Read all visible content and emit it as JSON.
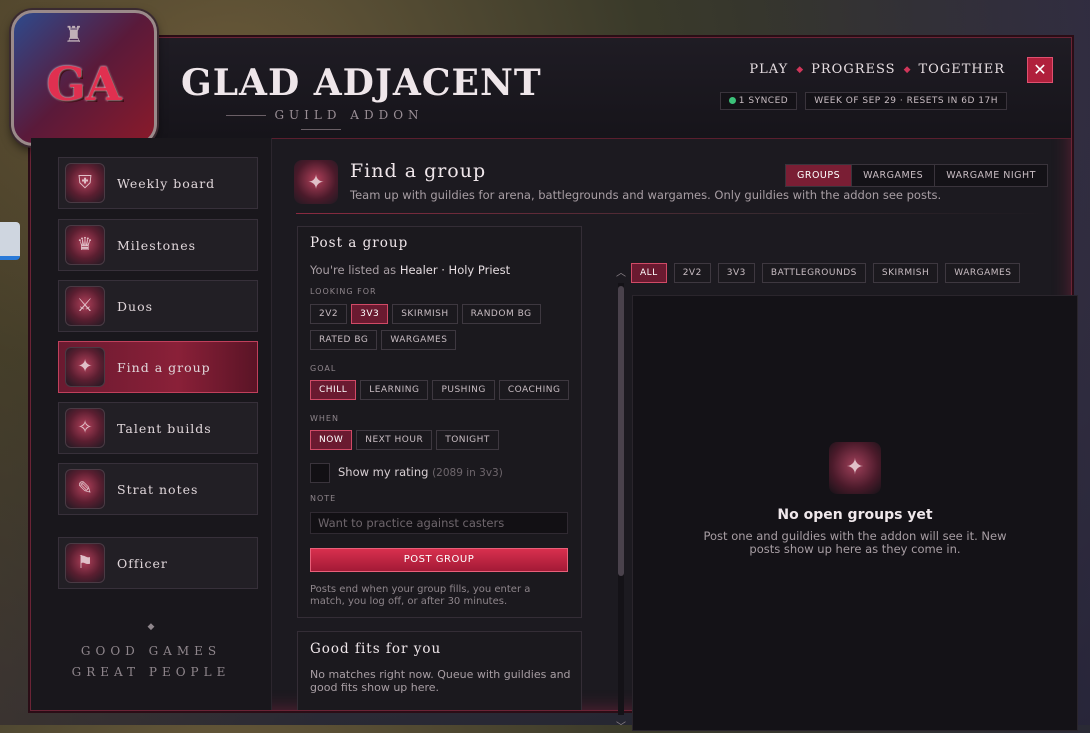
{
  "app": {
    "title": "GLAD ADJACENT",
    "subtitle": "GUILD ADDON",
    "logo_text": "GA"
  },
  "topnav": {
    "items": [
      "PLAY",
      "PROGRESS",
      "TOGETHER"
    ]
  },
  "status": {
    "synced": "1 SYNCED",
    "week": "WEEK OF SEP 29 · RESETS IN 6D 17H",
    "synced_color": "#3cc27a"
  },
  "colors": {
    "accent": "#c8284a",
    "active_bg": "#7a1e34",
    "panel_bg": "#1b191e"
  },
  "sidebar": {
    "items": [
      {
        "label": "Weekly board",
        "icon": "shield-crest-icon"
      },
      {
        "label": "Milestones",
        "icon": "trophy-crest-icon"
      },
      {
        "label": "Duos",
        "icon": "crossed-swords-icon"
      },
      {
        "label": "Find a group",
        "icon": "group-crest-icon",
        "active": true
      },
      {
        "label": "Talent builds",
        "icon": "spellbook-icon"
      },
      {
        "label": "Strat notes",
        "icon": "scroll-icon"
      },
      {
        "label": "Officer",
        "icon": "banners-icon"
      }
    ],
    "motto": [
      "GOOD GAMES",
      "GREAT PEOPLE"
    ]
  },
  "page": {
    "title": "Find a group",
    "description": "Team up with guildies for arena, battlegrounds and wargames. Only guildies with the addon see posts.",
    "tabs": [
      {
        "label": "GROUPS",
        "active": true
      },
      {
        "label": "WARGAMES"
      },
      {
        "label": "WARGAME NIGHT"
      }
    ]
  },
  "post": {
    "title": "Post a group",
    "listed_prefix": "You're listed as",
    "listed_role": "Healer · Holy Priest",
    "looking_for_label": "LOOKING FOR",
    "looking_for": [
      {
        "label": "2V2"
      },
      {
        "label": "3V3",
        "on": true
      },
      {
        "label": "SKIRMISH"
      },
      {
        "label": "RANDOM BG"
      },
      {
        "label": "RATED BG"
      },
      {
        "label": "WARGAMES"
      }
    ],
    "goal_label": "GOAL",
    "goal": [
      {
        "label": "CHILL",
        "on": true
      },
      {
        "label": "LEARNING"
      },
      {
        "label": "PUSHING"
      },
      {
        "label": "COACHING"
      }
    ],
    "when_label": "WHEN",
    "when": [
      {
        "label": "NOW",
        "on": true
      },
      {
        "label": "NEXT HOUR"
      },
      {
        "label": "TONIGHT"
      }
    ],
    "show_rating_label": "Show my rating",
    "rating_hint": "(2089 in 3v3)",
    "show_rating_checked": false,
    "note_label": "NOTE",
    "note_placeholder": "Want to practice against casters",
    "submit_label": "POST GROUP",
    "footnote": "Posts end when your group fills, you enter a match, you log off, or after 30 minutes."
  },
  "fits": {
    "title": "Good fits for you",
    "text": "No matches right now. Queue with guildies and good fits show up here."
  },
  "filters": [
    {
      "label": "ALL",
      "on": true
    },
    {
      "label": "2V2"
    },
    {
      "label": "3V3"
    },
    {
      "label": "BATTLEGROUNDS"
    },
    {
      "label": "SKIRMISH"
    },
    {
      "label": "WARGAMES"
    }
  ],
  "empty": {
    "title": "No open groups yet",
    "text": "Post one and guildies with the addon will see it. New posts show up here as they come in."
  }
}
